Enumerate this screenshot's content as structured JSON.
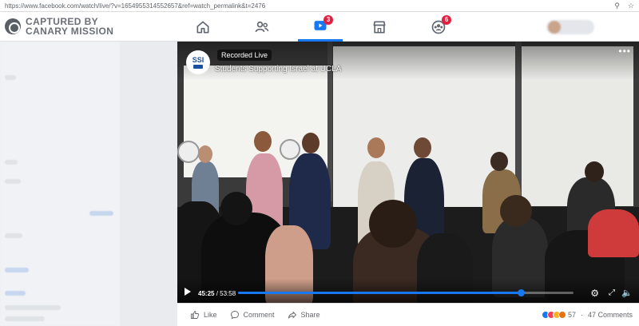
{
  "browser": {
    "url": "https://www.facebook.com/watch/live/?v=1654955314552657&ref=watch_permalink&t=2476",
    "icons": [
      "zoom-icon",
      "star-icon"
    ]
  },
  "brand": {
    "line1": "CAPTURED BY",
    "line2": "CANARY MISSION"
  },
  "nav": {
    "tabs": [
      {
        "name": "home",
        "icon": "home-icon",
        "badge": ""
      },
      {
        "name": "friends",
        "icon": "friends-icon",
        "badge": ""
      },
      {
        "name": "watch",
        "icon": "watch-icon",
        "badge": "3",
        "active": true
      },
      {
        "name": "marketplace",
        "icon": "marketplace-icon",
        "badge": ""
      },
      {
        "name": "groups",
        "icon": "groups-icon",
        "badge": "6"
      }
    ],
    "accent": "#1877f2",
    "badge_color": "#e41e3f"
  },
  "video": {
    "page_avatar": "SSI",
    "status": "Recorded Live",
    "title": "Students Supporting Israel at UCLA",
    "menu": "•••",
    "elapsed": "45:25",
    "duration": "53:58",
    "progress": 0.842
  },
  "actions": {
    "like": "Like",
    "comment": "Comment",
    "share": "Share",
    "reaction_count": "57",
    "separator": "·",
    "comments": "47 Comments"
  }
}
